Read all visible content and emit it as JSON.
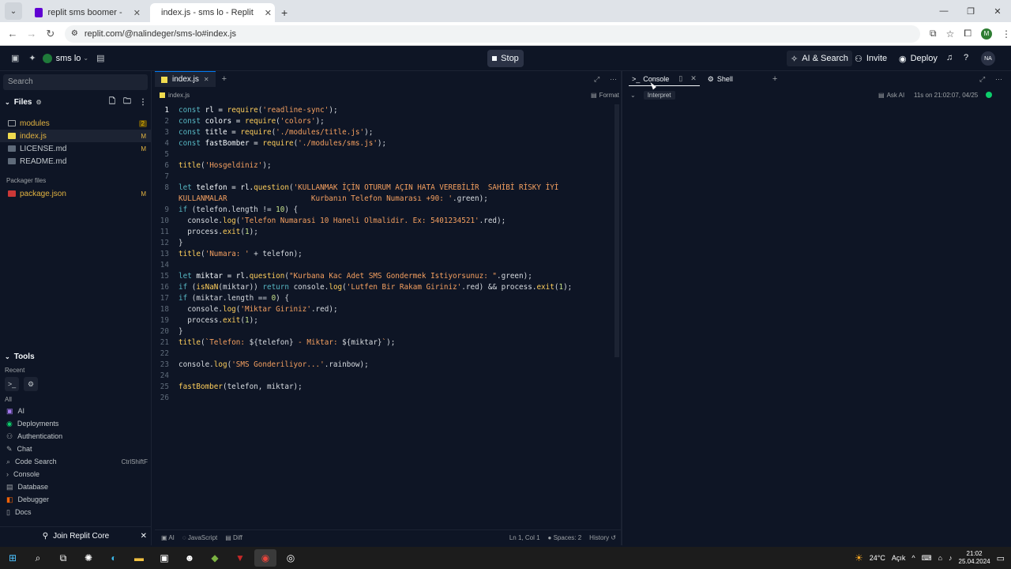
{
  "browser": {
    "tabs": [
      {
        "title": "replit sms boomer - Yahoo Tur",
        "favicon_color": "#6001d2"
      },
      {
        "title": "index.js - sms lo - Replit",
        "favicon_color": "#f26207"
      }
    ],
    "url": "replit.com/@nalindeger/sms-lo#index.js",
    "profile_initial": "M"
  },
  "header": {
    "repl_name": "sms lo",
    "stop_label": "Stop",
    "ai_search_label": "AI & Search",
    "invite_label": "Invite",
    "deploy_label": "Deploy",
    "user_initials": "NA"
  },
  "sidebar": {
    "search_placeholder": "Search",
    "files_label": "Files",
    "files": [
      {
        "name": "modules",
        "badge": "2",
        "kind": "folder"
      },
      {
        "name": "index.js",
        "badge": "M",
        "kind": "js"
      },
      {
        "name": "LICENSE.md",
        "badge": "M",
        "kind": "md"
      },
      {
        "name": "README.md",
        "badge": "",
        "kind": "md"
      }
    ],
    "packager_label": "Packager files",
    "packager_files": [
      {
        "name": "package.json",
        "badge": "M"
      }
    ],
    "tools_label": "Tools",
    "recent_label": "Recent",
    "all_label": "All",
    "tools": [
      {
        "label": "AI",
        "key": "",
        "icon": "ai-icon"
      },
      {
        "label": "Deployments",
        "key": "",
        "icon": "deployments-icon"
      },
      {
        "label": "Authentication",
        "key": "",
        "icon": "auth-icon"
      },
      {
        "label": "Chat",
        "key": "",
        "icon": "chat-icon"
      },
      {
        "label": "Code Search",
        "key": "CtrlShiftF",
        "icon": "code-search-icon"
      },
      {
        "label": "Console",
        "key": "",
        "icon": "console-icon"
      },
      {
        "label": "Database",
        "key": "",
        "icon": "database-icon"
      },
      {
        "label": "Debugger",
        "key": "",
        "icon": "debugger-icon"
      },
      {
        "label": "Docs",
        "key": "",
        "icon": "docs-icon"
      }
    ],
    "join_label": "Join Replit Core"
  },
  "editor": {
    "tab_label": "index.js",
    "breadcrumb": "index.js",
    "format_label": "Format",
    "status": {
      "ai": "AI",
      "language": "JavaScript",
      "diff": "Diff",
      "position": "Ln 1, Col 1",
      "spaces": "Spaces: 2",
      "history": "History"
    }
  },
  "console": {
    "console_tab": "Console",
    "shell_tab": "Shell",
    "interpret_label": "Interpret",
    "ask_ai_label": "Ask AI",
    "timestamp": "11s on 21:02:07, 04/25"
  },
  "taskbar": {
    "weather": "24°C",
    "weather_desc": "Açık",
    "time": "21:02",
    "date": "25.04.2024"
  }
}
